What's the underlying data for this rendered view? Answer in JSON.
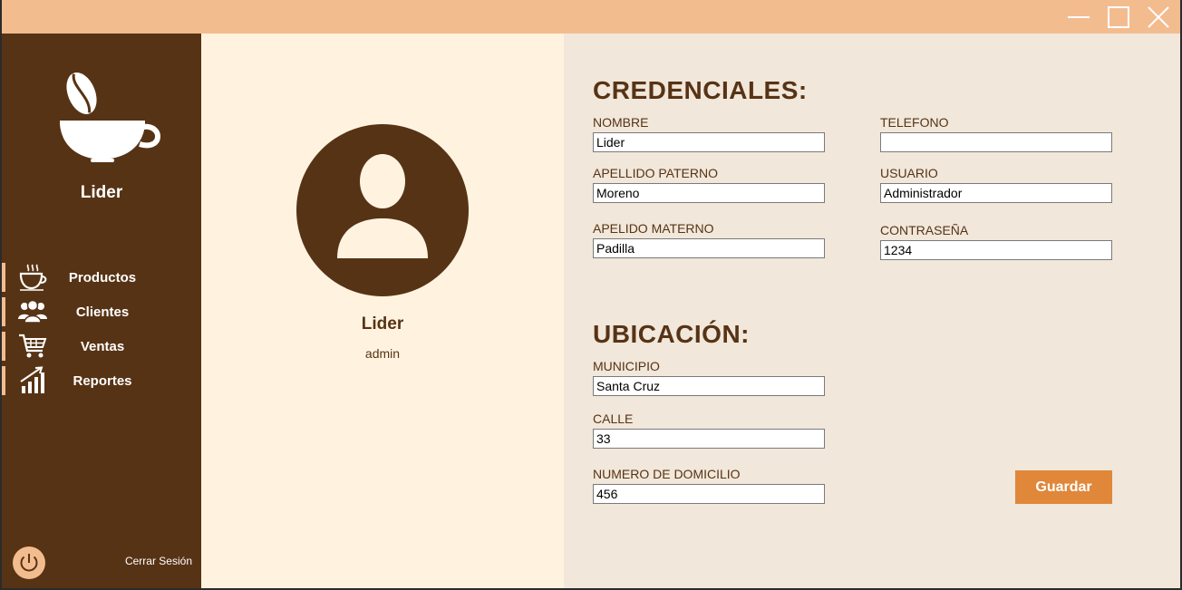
{
  "window": {
    "controls": [
      "minimize-icon",
      "maximize-icon",
      "close-icon"
    ],
    "titlebar_color": "#f3bc8f"
  },
  "colors": {
    "primary": "#573315",
    "accent": "#f3bc8f",
    "button": "#e0873a",
    "panel_bg": "#fff3e0",
    "form_bg": "#f1e7da"
  },
  "sidebar": {
    "logo_icon": "coffee-cup-bean-icon",
    "user_name": "Lider",
    "items": [
      {
        "label": "Productos",
        "icon": "coffee-cup-icon"
      },
      {
        "label": "Clientes",
        "icon": "users-icon"
      },
      {
        "label": "Ventas",
        "icon": "shopping-cart-icon"
      },
      {
        "label": "Reportes",
        "icon": "chart-growth-icon"
      }
    ],
    "logout_label": "Cerrar Sesión",
    "logout_icon": "power-icon"
  },
  "profile": {
    "avatar_icon": "user-avatar-icon",
    "name": "Lider",
    "role": "admin"
  },
  "credenciales": {
    "title": "CREDENCIALES:",
    "nombre_label": "NOMBRE",
    "nombre_value": "Lider",
    "apellido_paterno_label": "APELLIDO PATERNO",
    "apellido_paterno_value": "Moreno",
    "apellido_materno_label": "APELIDO MATERNO",
    "apellido_materno_value": "Padilla",
    "telefono_label": "TELEFONO",
    "telefono_value": "",
    "usuario_label": "USUARIO",
    "usuario_value": "Administrador",
    "contrasena_label": "CONTRASEÑA",
    "contrasena_value": "1234"
  },
  "ubicacion": {
    "title": "UBICACIÓN:",
    "municipio_label": "MUNICIPIO",
    "municipio_value": "Santa Cruz",
    "calle_label": "CALLE",
    "calle_value": "33",
    "numero_label": "NUMERO DE DOMICILIO",
    "numero_value": "456"
  },
  "actions": {
    "save_label": "Guardar"
  }
}
